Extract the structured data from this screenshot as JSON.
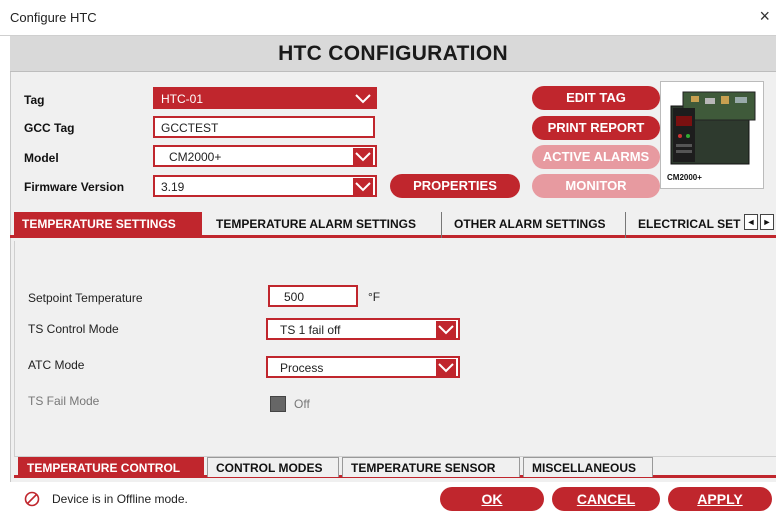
{
  "window": {
    "title": "Configure HTC",
    "close_glyph": "×"
  },
  "header": {
    "title": "HTC CONFIGURATION"
  },
  "form": {
    "tag": {
      "label": "Tag",
      "value": "HTC-01"
    },
    "gcc_tag": {
      "label": "GCC Tag",
      "value": "GCCTEST"
    },
    "model": {
      "label": "Model",
      "value": "CM2000+"
    },
    "firmware": {
      "label": "Firmware Version",
      "value": "3.19"
    }
  },
  "actions": {
    "edit_tag": "EDIT TAG",
    "print_report": "PRINT REPORT",
    "active_alarms": "ACTIVE ALARMS",
    "monitor": "MONITOR",
    "properties": "PROPERTIES"
  },
  "device_image": {
    "caption": "CM2000+"
  },
  "tabs": [
    {
      "label": "TEMPERATURE SETTINGS",
      "active": true
    },
    {
      "label": "TEMPERATURE ALARM SETTINGS",
      "active": false
    },
    {
      "label": "OTHER ALARM SETTINGS",
      "active": false
    },
    {
      "label": "ELECTRICAL SET",
      "active": false
    }
  ],
  "tab_scroll": {
    "left": "◄",
    "right": "►"
  },
  "settings": {
    "setpoint": {
      "label": "Setpoint Temperature",
      "value": "500",
      "unit": "°F"
    },
    "ts_control_mode": {
      "label": "TS Control Mode",
      "value": "TS 1 fail off"
    },
    "atc_mode": {
      "label": "ATC Mode",
      "value": "Process"
    },
    "ts_fail_mode": {
      "label": "TS Fail Mode",
      "value": "Off"
    }
  },
  "sub_tabs": [
    {
      "label": "TEMPERATURE CONTROL",
      "active": true
    },
    {
      "label": "CONTROL MODES",
      "active": false
    },
    {
      "label": "TEMPERATURE SENSOR",
      "active": false
    },
    {
      "label": "MISCELLANEOUS",
      "active": false
    }
  ],
  "status": {
    "message": "Device is in Offline mode."
  },
  "footer": {
    "ok": "OK",
    "cancel": "CANCEL",
    "apply": "APPLY"
  },
  "colors": {
    "accent": "#c0262d",
    "accent_disabled": "#e79aa0",
    "panel": "#f0f0f0",
    "banner": "#d9d9d9"
  }
}
